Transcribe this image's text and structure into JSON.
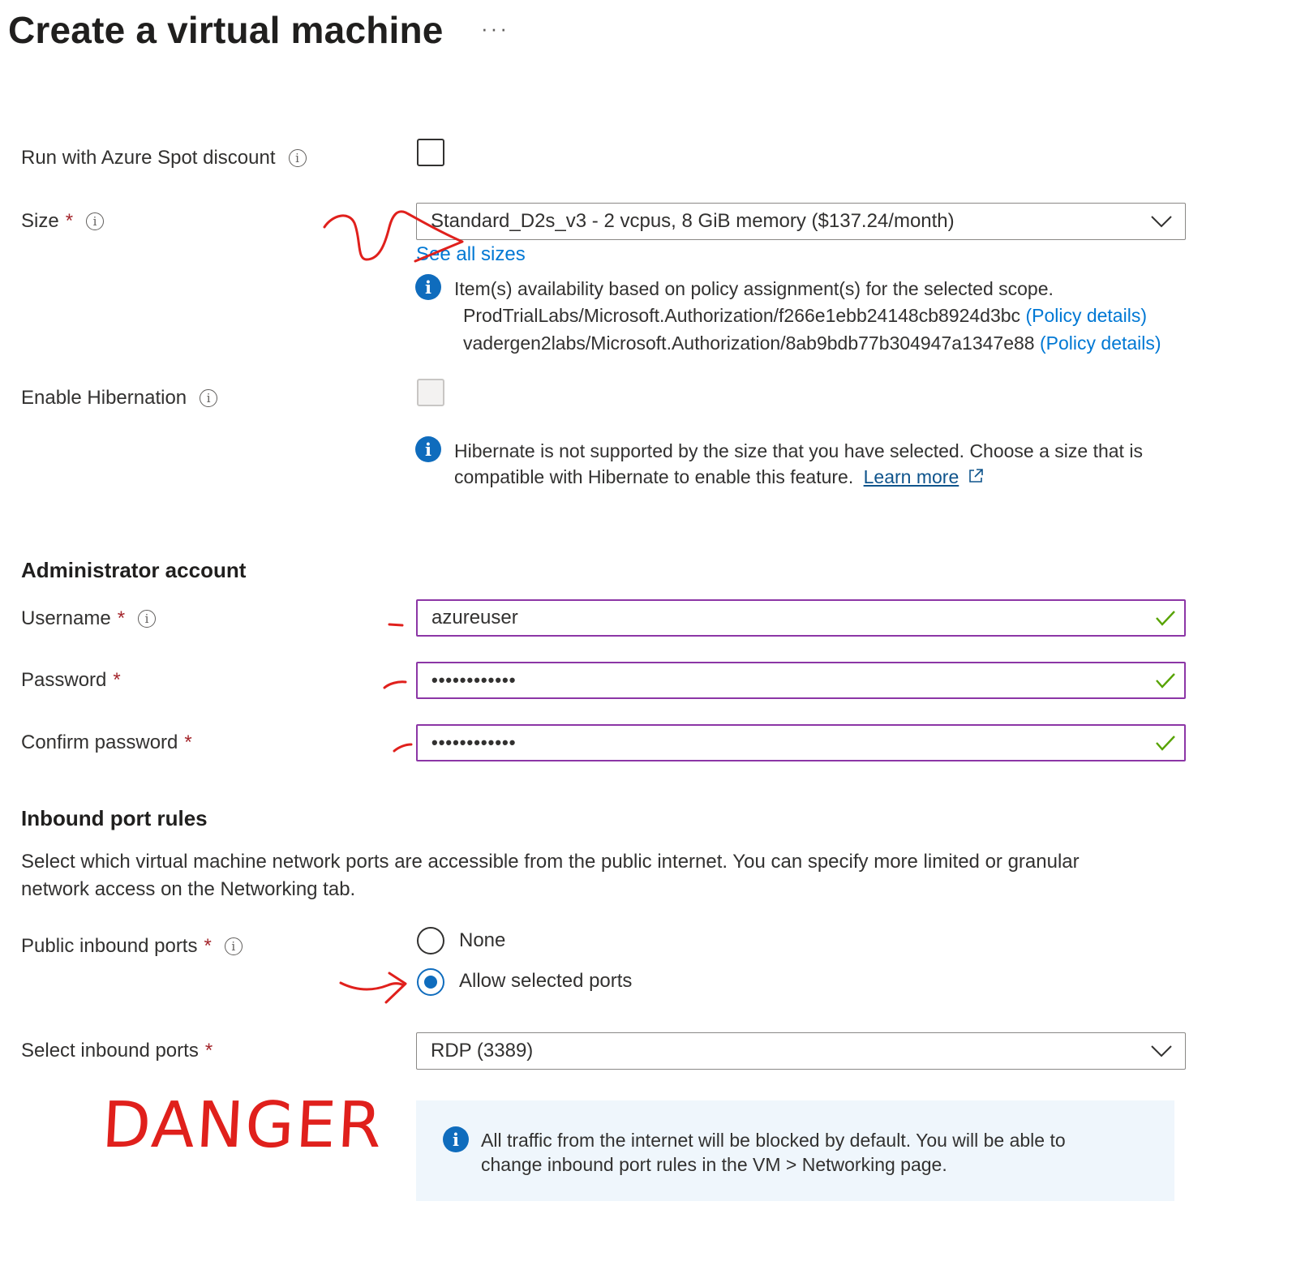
{
  "page": {
    "title": "Create a virtual machine",
    "more": "···"
  },
  "spot": {
    "label": "Run with Azure Spot discount",
    "checked": false
  },
  "size": {
    "label": "Size",
    "required": "*",
    "value": "Standard_D2s_v3 - 2 vcpus, 8 GiB memory ($137.24/month)",
    "see_all": "See all sizes",
    "policy_message": "Item(s) availability based on policy assignment(s) for the selected scope.",
    "policies": [
      {
        "path": "ProdTrialLabs/Microsoft.Authorization/f266e1ebb24148cb8924d3bc",
        "link": "(Policy details)"
      },
      {
        "path": "vadergen2labs/Microsoft.Authorization/8ab9bdb77b304947a1347e88",
        "link": "(Policy details)"
      }
    ]
  },
  "hibernation": {
    "label": "Enable Hibernation",
    "checked": false,
    "disabled": true,
    "message": "Hibernate is not supported by the size that you have selected. Choose a size that is",
    "message_line2": "compatible with Hibernate to enable this feature.",
    "learn_more": "Learn more"
  },
  "admin": {
    "heading": "Administrator account",
    "username_label": "Username",
    "username_value": "azureuser",
    "password_label": "Password",
    "password_value": "••••••••••••",
    "confirm_label": "Confirm password",
    "confirm_value": "••••••••••••",
    "required": "*"
  },
  "inbound": {
    "heading": "Inbound port rules",
    "description_line1": "Select which virtual machine network ports are accessible from the public internet. You can specify more limited or granular",
    "description_line2": "network access on the Networking tab.",
    "public_label": "Public inbound ports",
    "options": [
      "None",
      "Allow selected ports"
    ],
    "selected_option": "Allow selected ports",
    "select_label": "Select inbound ports",
    "select_value": "RDP (3389)",
    "info_line1": "All traffic from the internet will be blocked by default. You will be able to",
    "info_line2": "change inbound port rules in the VM > Networking page.",
    "required": "*"
  },
  "annotations": {
    "danger_text": "DANGER",
    "ink_color": "#e0201c"
  },
  "colors": {
    "link": "#0078d4",
    "info_icon": "#0f6cbd",
    "required": "#a4262c",
    "valid_border": "#8c36a6",
    "valid_check": "#57a300",
    "info_box": "#eff6fc"
  }
}
